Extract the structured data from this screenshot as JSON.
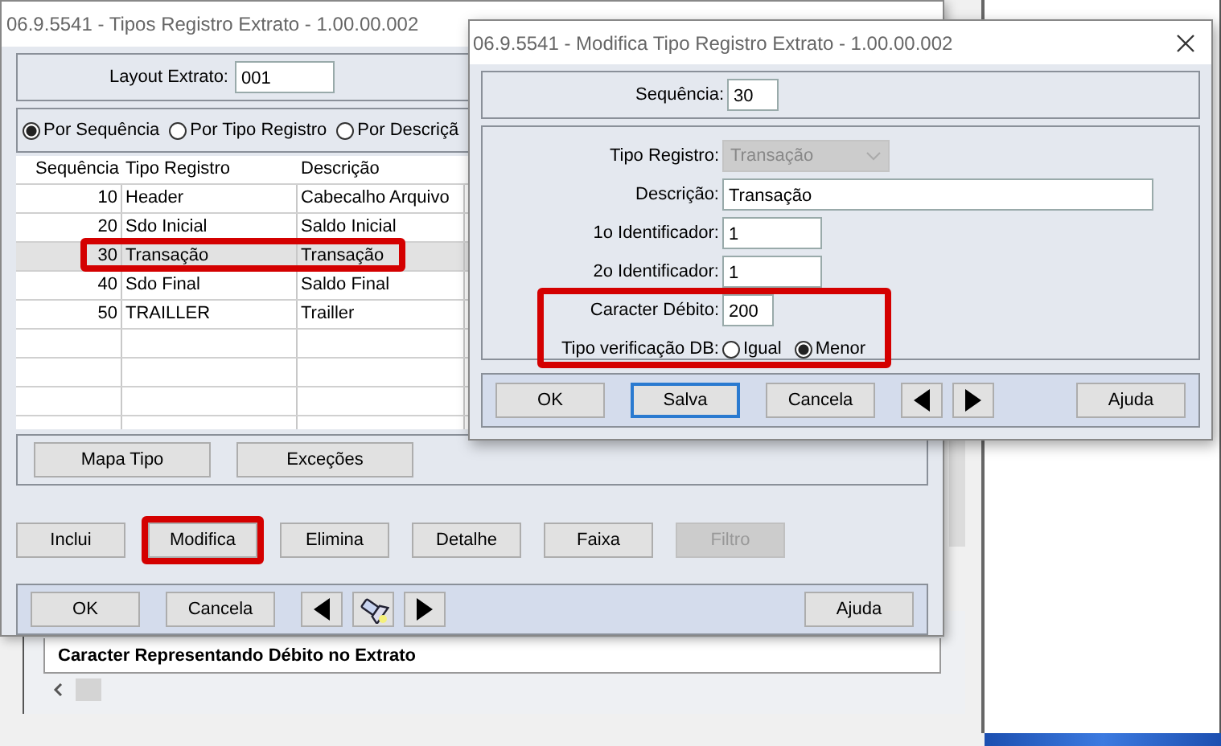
{
  "background": {
    "list_row": "Caracter Representando Débito no Extrato"
  },
  "main_window": {
    "title": "06.9.5541 - Tipos Registro Extrato - 1.00.00.002",
    "layout": {
      "label": "Layout Extrato:",
      "value": "001"
    },
    "sort_options": [
      {
        "label": "Por Sequência",
        "selected": true
      },
      {
        "label": "Por Tipo Registro",
        "selected": false
      },
      {
        "label": "Por Descriçã",
        "selected": false
      }
    ],
    "table": {
      "columns": [
        "Sequência",
        "Tipo Registro",
        "Descrição"
      ],
      "rows": [
        {
          "cells": [
            "10",
            "Header",
            "Cabecalho Arquivo"
          ],
          "selected": false,
          "highlighted": false
        },
        {
          "cells": [
            "20",
            "Sdo Inicial",
            "Saldo Inicial"
          ],
          "selected": false,
          "highlighted": false
        },
        {
          "cells": [
            "30",
            "Transação",
            "Transação"
          ],
          "selected": true,
          "highlighted": true
        },
        {
          "cells": [
            "40",
            "Sdo Final",
            "Saldo Final"
          ],
          "selected": false,
          "highlighted": false
        },
        {
          "cells": [
            "50",
            "TRAILLER",
            "Trailler"
          ],
          "selected": false,
          "highlighted": false
        }
      ]
    },
    "panel_buttons": [
      "Mapa Tipo",
      "Exceções"
    ],
    "action_buttons": [
      {
        "label": "Inclui",
        "disabled": false,
        "highlighted": false
      },
      {
        "label": "Modifica",
        "disabled": false,
        "highlighted": true
      },
      {
        "label": "Elimina",
        "disabled": false,
        "highlighted": false
      },
      {
        "label": "Detalhe",
        "disabled": false,
        "highlighted": false
      },
      {
        "label": "Faixa",
        "disabled": false,
        "highlighted": false
      },
      {
        "label": "Filtro",
        "disabled": true,
        "highlighted": false
      }
    ],
    "footer_buttons": [
      {
        "kind": "text",
        "label": "OK"
      },
      {
        "kind": "text",
        "label": "Cancela"
      },
      {
        "kind": "prev"
      },
      {
        "kind": "flashlight"
      },
      {
        "kind": "next"
      },
      {
        "kind": "spacer"
      },
      {
        "kind": "text",
        "label": "Ajuda"
      }
    ]
  },
  "dialog": {
    "title": "06.9.5541 - Modifica Tipo Registro Extrato - 1.00.00.002",
    "sequence": {
      "label": "Sequência:",
      "value": "30"
    },
    "fields": [
      {
        "kind": "select",
        "label": "Tipo Registro:",
        "value": "Transação",
        "disabled": true,
        "highlighted": false
      },
      {
        "kind": "wide",
        "label": "Descrição:",
        "value": "Transação",
        "highlighted": false
      },
      {
        "kind": "short",
        "label": "1o Identificador:",
        "value": "1",
        "highlighted": false
      },
      {
        "kind": "short",
        "label": "2o Identificador:",
        "value": "1",
        "highlighted": false
      },
      {
        "kind": "tiny",
        "label": "Caracter Débito:",
        "value": "200",
        "highlighted": true
      },
      {
        "kind": "radio",
        "label": "Tipo verificação DB:",
        "options": [
          {
            "label": "Igual",
            "selected": false
          },
          {
            "label": "Menor",
            "selected": true
          }
        ],
        "highlighted": true
      }
    ],
    "buttons": [
      {
        "kind": "text",
        "label": "OK",
        "focused": false
      },
      {
        "kind": "text",
        "label": "Salva",
        "focused": true
      },
      {
        "kind": "text",
        "label": "Cancela",
        "focused": false
      },
      {
        "kind": "prev"
      },
      {
        "kind": "next"
      },
      {
        "kind": "spacer"
      },
      {
        "kind": "text",
        "label": "Ajuda",
        "focused": false
      }
    ]
  }
}
